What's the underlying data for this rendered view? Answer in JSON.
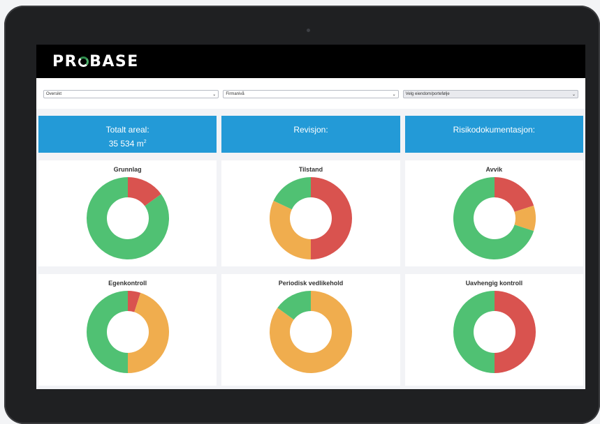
{
  "app": {
    "logo": "PROBASE"
  },
  "filters": [
    {
      "value": "Oversikt"
    },
    {
      "value": "Firmanivå"
    },
    {
      "value": "Velg eiendom/portefølje"
    }
  ],
  "kpis": [
    {
      "label": "Totalt areal:",
      "value": "35 534 m",
      "sup": "2"
    },
    {
      "label": "Revisjon:"
    },
    {
      "label": "Risikodokumentasjon:"
    }
  ],
  "colors": {
    "red": "#d9534f",
    "orange": "#f0ad4e",
    "green": "#50c173",
    "kpi": "#239ad7"
  },
  "chart_data": [
    {
      "type": "pie",
      "title": "Grunnlag",
      "values": [
        {
          "color": "red",
          "value": 0.15
        },
        {
          "color": "green",
          "value": 0.85
        }
      ]
    },
    {
      "type": "pie",
      "title": "Tilstand",
      "values": [
        {
          "color": "red",
          "value": 0.5
        },
        {
          "color": "orange",
          "value": 0.32
        },
        {
          "color": "green",
          "value": 0.18
        }
      ]
    },
    {
      "type": "pie",
      "title": "Avvik",
      "values": [
        {
          "color": "red",
          "value": 0.2
        },
        {
          "color": "orange",
          "value": 0.1
        },
        {
          "color": "green",
          "value": 0.7
        }
      ]
    },
    {
      "type": "pie",
      "title": "Egenkontroll",
      "values": [
        {
          "color": "red",
          "value": 0.05
        },
        {
          "color": "orange",
          "value": 0.45
        },
        {
          "color": "green",
          "value": 0.5
        }
      ]
    },
    {
      "type": "pie",
      "title": "Periodisk vedlikehold",
      "values": [
        {
          "color": "orange",
          "value": 0.85
        },
        {
          "color": "green",
          "value": 0.15
        }
      ]
    },
    {
      "type": "pie",
      "title": "Uavhengig kontroll",
      "values": [
        {
          "color": "red",
          "value": 0.5
        },
        {
          "color": "green",
          "value": 0.5
        }
      ]
    }
  ]
}
